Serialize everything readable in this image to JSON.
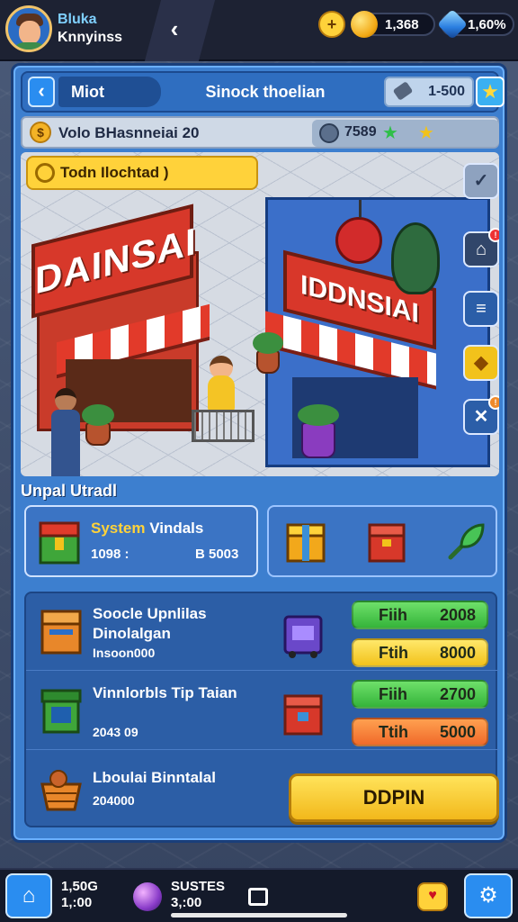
{
  "profile": {
    "name_line1": "Bluka",
    "name_line2": "Knnyinss"
  },
  "top_resources": {
    "plus_icon": "plus-badge-icon",
    "gold": "1,368",
    "gems": "1,60%"
  },
  "header": {
    "back_label": "Miot",
    "title": "Sinock thoelian",
    "resource_value": "1-500"
  },
  "info_bar": {
    "text": "Volo BHasnneiai 20",
    "right_value": "7589"
  },
  "scene": {
    "quest_label": "Todn Ilochtad )",
    "red_shop_sign": "DAINSAI",
    "blue_shop_sign": "IDDNSIAI"
  },
  "section": {
    "title": "Unpal Utradl"
  },
  "system_card": {
    "title_a": "System",
    "title_b": " Vindals",
    "value_left": "1098 :",
    "value_right": "B 5003"
  },
  "offers": [
    {
      "title": "Soocle Upnlilas Dinolalgan",
      "sub": "Insoon000",
      "buttons": [
        {
          "label": "Fiih",
          "value": "2008",
          "color": "green"
        },
        {
          "label": "Ftih",
          "value": "8000",
          "color": "yellow"
        }
      ]
    },
    {
      "title": "Vinnlorbls Tip Taian",
      "sub": "2043 09",
      "buttons": [
        {
          "label": "Fiih",
          "value": "2700",
          "color": "green"
        },
        {
          "label": "Ttih",
          "value": "5000",
          "color": "orange"
        }
      ]
    },
    {
      "title": "Lboulai Binntalal",
      "sub": "204000",
      "button": "DDPIN"
    }
  ],
  "bottom": {
    "stat1_line1": "1,50G",
    "stat1_line2": "1,:00",
    "stat2_line1": "SUSTES",
    "stat2_line2": "3,:00"
  },
  "colors": {
    "panel": "#3d7fcf",
    "accent_yellow": "#ffd23a",
    "accent_green": "#35b43a",
    "accent_orange": "#f06a2a"
  }
}
